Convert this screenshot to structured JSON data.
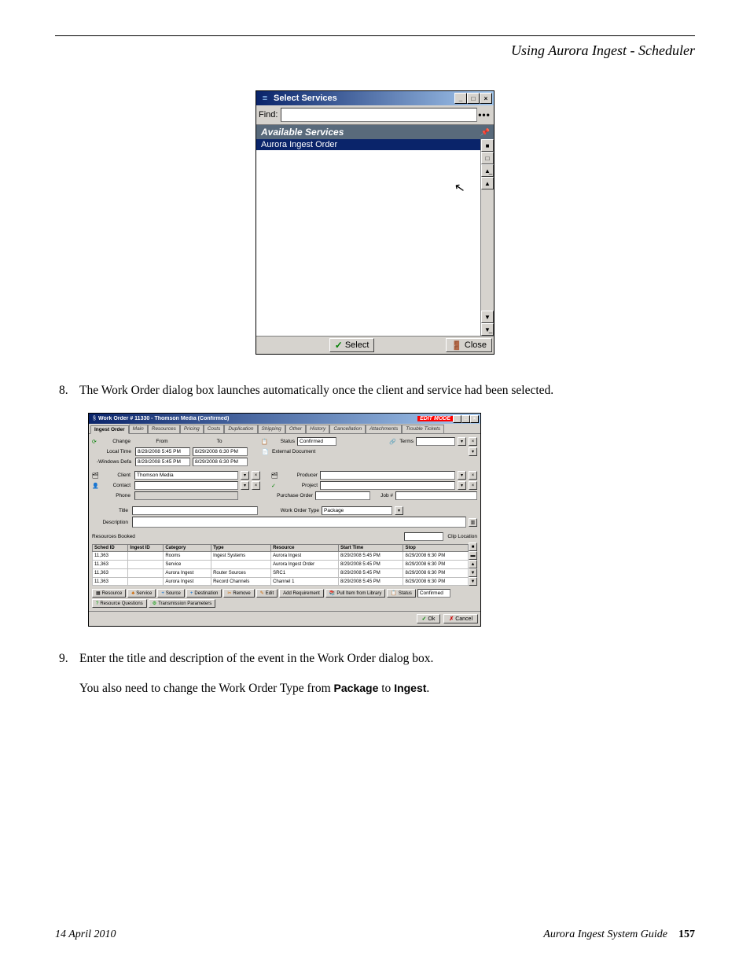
{
  "header": {
    "section_title": "Using Aurora Ingest - Scheduler"
  },
  "select_services": {
    "title": "Select Services",
    "find_label": "Find:",
    "find_value": "",
    "dots": "•••",
    "available_header": "Available Services",
    "selected_item": "Aurora Ingest Order",
    "select_btn": "Select",
    "close_btn": "Close"
  },
  "steps": {
    "s8_num": "8.",
    "s8_text": "The Work Order dialog box launches automatically once the client and service had been selected.",
    "s9_num": "9.",
    "s9_a": "Enter the title and description of the event in the Work Order dialog box.",
    "s9_b_pre": "You also need to change the Work Order Type from ",
    "s9_b_bold1": "Package",
    "s9_b_mid": " to ",
    "s9_b_bold2": "Ingest",
    "s9_b_post": "."
  },
  "work_order": {
    "title": "Work Order # 11330 - Thomson Media (Confirmed)",
    "edit_mode": "EDIT MODE",
    "tabs": [
      "Ingest Order",
      "Main",
      "Resources",
      "Pricing",
      "Costs",
      "Duplication",
      "Shipping",
      "Other",
      "History",
      "Cancellation",
      "Attachments",
      "Trouble Tickets"
    ],
    "change": "Change",
    "from": "From",
    "to": "To",
    "local_time": "Local Time",
    "windows_defa": "-Windows Defa",
    "from_val": "8/29/2008 5:45 PM",
    "to_val": "8/29/2008 6:30 PM",
    "status_lbl": "Status",
    "status_val": "Confirmed",
    "extdoc": "External Document",
    "terms": "Terms",
    "client_lbl": "Client",
    "client_val": "Thomson Media",
    "contact_lbl": "Contact",
    "phone_lbl": "Phone",
    "producer_lbl": "Producer",
    "project_lbl": "Project",
    "po_lbl": "Purchase Order",
    "jobnum": "Job #",
    "title_lbl": "Title",
    "wotype_lbl": "Work Order Type",
    "wotype_val": "Package",
    "desc_lbl": "Description",
    "res_booked": "Resources Booked",
    "clip_loc": "Clip Location",
    "table": {
      "cols": [
        "Sched ID",
        "Ingest ID",
        "Category",
        "Type",
        "Resource",
        "Start Time",
        "Stop"
      ],
      "rows": [
        [
          "11,363",
          "",
          "Rooms",
          "Ingest Systems",
          "Aurora Ingest",
          "8/29/2008 5:45 PM",
          "8/29/2008 6:30 PM"
        ],
        [
          "11,363",
          "",
          "Service",
          "",
          "Aurora Ingest Order",
          "8/29/2008 5:45 PM",
          "8/29/2008 6:30 PM"
        ],
        [
          "11,363",
          "",
          "Aurora Ingest",
          "Router Sources",
          "SRC1",
          "8/29/2008 5:45 PM",
          "8/29/2008 6:30 PM"
        ],
        [
          "11,363",
          "",
          "Aurora Ingest",
          "Record Channels",
          "Channel 1",
          "8/29/2008 5:45 PM",
          "8/29/2008 6:30 PM"
        ]
      ]
    },
    "btns": {
      "resource": "Resource",
      "service": "Service",
      "source": "Source",
      "destination": "Destination",
      "remove": "Remove",
      "edit": "Edit",
      "addreq": "Add Requirement",
      "pull": "Pull Item from Library",
      "status": "Status",
      "confirmed": "Confirmed",
      "resq": "Resource Questions",
      "txparam": "Transmission Parameters"
    },
    "ok": "Ok",
    "cancel": "Cancel"
  },
  "footer": {
    "date": "14 April 2010",
    "guide": "Aurora Ingest System Guide",
    "page": "157"
  }
}
